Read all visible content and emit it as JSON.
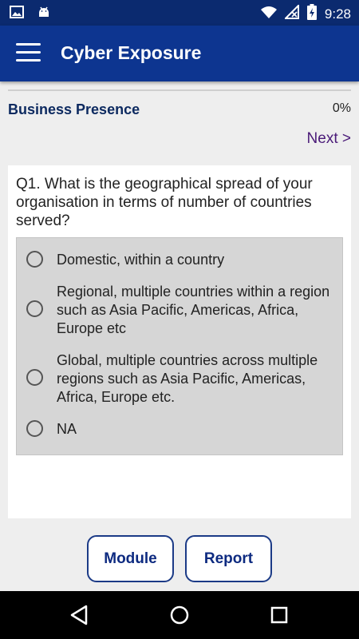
{
  "status_bar": {
    "time": "9:28",
    "icons": [
      "image-icon",
      "android-icon",
      "wifi-icon",
      "no-signal-icon",
      "battery-charging-icon"
    ]
  },
  "app_bar": {
    "title": "Cyber Exposure",
    "menu_icon": "hamburger-menu-icon"
  },
  "section": {
    "title": "Business Presence",
    "progress": "0%",
    "next_label": "Next >"
  },
  "question": {
    "text": "Q1. What is the geographical spread of your organisation in terms of number of countries served?",
    "options": [
      {
        "label": "Domestic, within a country",
        "selected": false
      },
      {
        "label": "Regional, multiple countries within a region such as Asia Pacific, Americas, Africa, Europe etc",
        "selected": false
      },
      {
        "label": "Global, multiple countries across multiple regions such as Asia Pacific, Americas, Africa, Europe etc.",
        "selected": false
      },
      {
        "label": "NA",
        "selected": false
      }
    ]
  },
  "buttons": {
    "module": "Module",
    "report": "Report"
  },
  "nav_bar": {
    "icons": [
      "back-icon",
      "home-icon",
      "recents-icon"
    ]
  },
  "colors": {
    "status_bar": "#0b2a6f",
    "app_bar": "#0d3590",
    "section_title": "#0d2a60",
    "next_link": "#4a1a78",
    "options_bg": "#d6d6d6"
  }
}
